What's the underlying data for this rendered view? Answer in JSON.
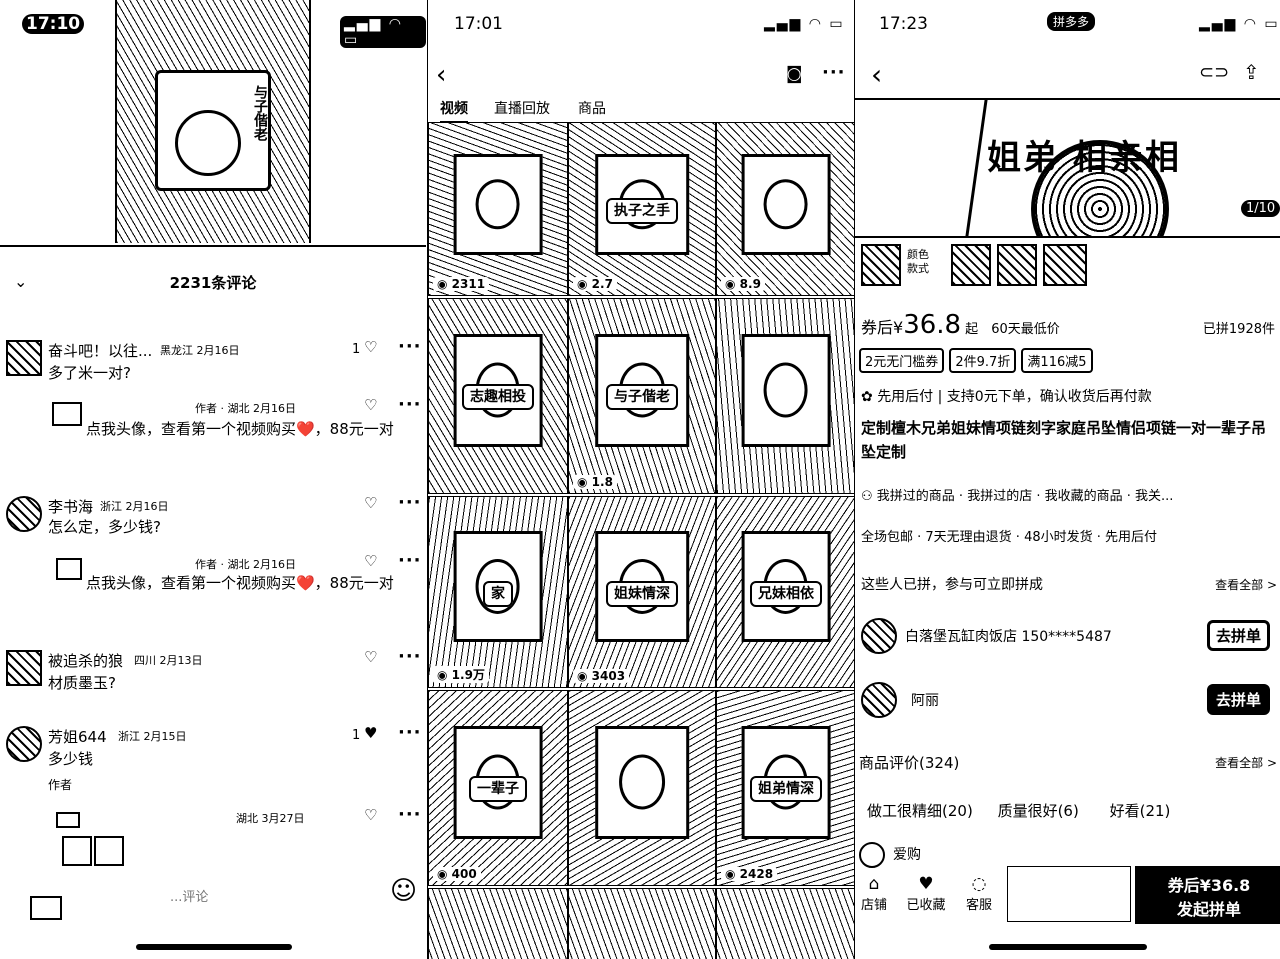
{
  "p1": {
    "time": "17:10",
    "video_caption": "与子偕老",
    "comments_title": "2231条评论",
    "comments": [
      {
        "name": "奋斗吧！以往...",
        "meta": "黑龙江 2月16日",
        "text": "多了米一对?",
        "likes": "1"
      },
      {
        "name": "",
        "meta": "作者 · 湖北 2月16日",
        "text": "点我头像，查看第一个视频购买❤️，88元一对",
        "likes": ""
      },
      {
        "name": "李书海",
        "meta": "浙江 2月16日",
        "text": "怎么定，多少钱?",
        "likes": ""
      },
      {
        "name": "",
        "meta": "作者 · 湖北 2月16日",
        "text": "点我头像，查看第一个视频购买❤️，88元一对",
        "likes": ""
      },
      {
        "name": "被追杀的狼",
        "meta": "四川 2月13日",
        "text": "材质墨玉?",
        "likes": ""
      },
      {
        "name": "芳姐644",
        "meta": "浙江 2月15日",
        "text": "多少钱",
        "likes": "1"
      },
      {
        "name": "",
        "meta": "作者",
        "text": "",
        "likes": ""
      },
      {
        "name": "",
        "meta": "湖北 3月27日",
        "text": "",
        "likes": ""
      }
    ],
    "input_placeholder": "...评论"
  },
  "p2": {
    "time": "17:01",
    "tabs": [
      "视频",
      "直播回放",
      "商品"
    ],
    "thumbs": [
      {
        "tag": "",
        "views": "2311"
      },
      {
        "tag": "执子之手",
        "views": "2.7"
      },
      {
        "tag": "",
        "views": "8.9"
      },
      {
        "tag": "志趣相投",
        "views": ""
      },
      {
        "tag": "与子偕老",
        "views": "1.8"
      },
      {
        "tag": "",
        "views": ""
      },
      {
        "tag": "家",
        "views": "1.9万"
      },
      {
        "tag": "姐妹情深",
        "views": "3403"
      },
      {
        "tag": "兄妹相依",
        "views": ""
      },
      {
        "tag": "一辈子",
        "views": "400"
      },
      {
        "tag": "",
        "views": ""
      },
      {
        "tag": "姐弟情深",
        "views": "2428"
      }
    ]
  },
  "p3": {
    "time": "17:23",
    "app_badge": "拼多多",
    "image_counter": "1/10",
    "banner_text": "姐弟 相亲相",
    "color_label": "颜色\n款式",
    "price_prefix": "券后¥",
    "price": "36.8",
    "price_suffix": "起",
    "lowest": "60天最低价",
    "sold": "已拼1928件",
    "coupons": [
      "2元无门槛券",
      "2件9.7折",
      "满116减5"
    ],
    "pay_later": "先用后付 | 支持0元下单，确认收货后再付款",
    "title": "定制檀木兄弟姐妹情项链刻字家庭吊坠情侣项链一对一辈子吊坠定制",
    "history": "我拼过的商品 · 我拼过的店 · 我收藏的商品 · 我关...",
    "services": "全场包邮 · 7天无理由退货 · 48小时发货 · 先用后付",
    "group_title": "这些人已拼，参与可立即拼成",
    "view_all": "查看全部 >",
    "groups": [
      {
        "name": "白落堡瓦缸肉饭店 150****5487",
        "btn": "去拼单"
      },
      {
        "name": "阿丽",
        "btn": "去拼单"
      }
    ],
    "reviews_title": "商品评价(324)",
    "review_tags": [
      "做工很精细(20)",
      "质量很好(6)",
      "好看(21)"
    ],
    "reviewer": "爱购",
    "bottom_nav": [
      "店铺",
      "已收藏",
      "客服"
    ],
    "buy_line1": "券后¥36.8",
    "buy_line2": "发起拼单"
  }
}
